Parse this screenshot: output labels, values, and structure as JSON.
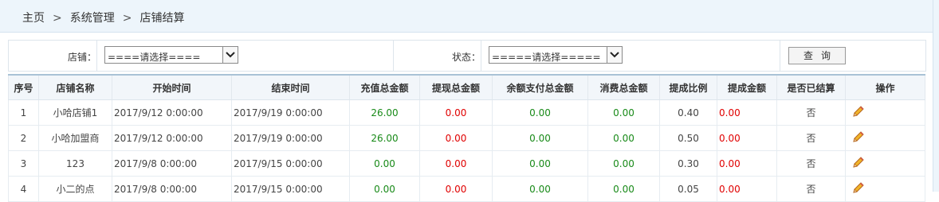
{
  "breadcrumb": {
    "home": "主页",
    "sep": ">",
    "system": "系统管理",
    "current": "店铺结算"
  },
  "filter": {
    "shop_label": "店铺：",
    "shop_value": "====请选择====",
    "status_label": "状态：",
    "status_value": "=====请选择=====",
    "query_button": "查询"
  },
  "table": {
    "headers": [
      "序号",
      "店铺名称",
      "开始时间",
      "结束时间",
      "充值总金额",
      "提现总金额",
      "余额支付总金额",
      "消费总金额",
      "提成比例",
      "提成金额",
      "是否已结算",
      "操作"
    ],
    "rows": [
      {
        "no": "1",
        "shop": "小哈店铺1",
        "start": "2017/9/12 0:00:00",
        "end": "2017/9/19 0:00:00",
        "recharge": "26.00",
        "withdraw": "0.00",
        "balance_pay": "0.00",
        "consume": "0.00",
        "ratio": "0.40",
        "commission": "0.00",
        "settled": "否"
      },
      {
        "no": "2",
        "shop": "小哈加盟商",
        "start": "2017/9/12 0:00:00",
        "end": "2017/9/19 0:00:00",
        "recharge": "26.00",
        "withdraw": "0.00",
        "balance_pay": "0.00",
        "consume": "0.00",
        "ratio": "0.50",
        "commission": "0.00",
        "settled": "否"
      },
      {
        "no": "3",
        "shop": "123",
        "start": "2017/9/8 0:00:00",
        "end": "2017/9/15 0:00:00",
        "recharge": "0.00",
        "withdraw": "0.00",
        "balance_pay": "0.00",
        "consume": "0.00",
        "ratio": "0.30",
        "commission": "0.00",
        "settled": "否"
      },
      {
        "no": "4",
        "shop": "小二的点",
        "start": "2017/9/8 0:00:00",
        "end": "2017/9/15 0:00:00",
        "recharge": "0.00",
        "withdraw": "0.00",
        "balance_pay": "0.00",
        "consume": "0.00",
        "ratio": "0.05",
        "commission": "0.00",
        "settled": "否"
      }
    ],
    "action_icon": "pencil-edit-icon"
  },
  "colors": {
    "positive": "#188a18",
    "negative": "#e00000",
    "header_bg": "#f2f6fa",
    "breadcrumb_bg": "#edf5fb"
  }
}
